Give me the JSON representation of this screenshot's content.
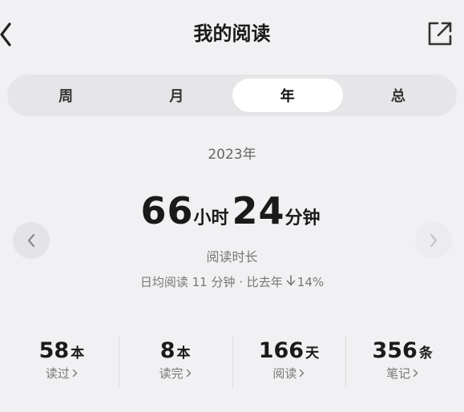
{
  "header": {
    "title": "我的阅读",
    "back_icon": "chevron-left-icon",
    "share_icon": "external-link-icon"
  },
  "tabs": [
    {
      "label": "周",
      "active": false
    },
    {
      "label": "月",
      "active": false
    },
    {
      "label": "年",
      "active": true
    },
    {
      "label": "总",
      "active": false
    }
  ],
  "period": {
    "label": "2023年"
  },
  "duration": {
    "hours": "66",
    "hours_unit": "小时",
    "minutes": "24",
    "minutes_unit": "分钟",
    "label": "阅读时长"
  },
  "daily": {
    "text": "日均阅读 11 分钟 · 比去年",
    "trend_icon": "arrow-down-icon",
    "change": "14%"
  },
  "nav": {
    "prev_icon": "chevron-left-icon",
    "next_icon": "chevron-right-icon"
  },
  "stats": [
    {
      "value": "58",
      "unit": "本",
      "label": "读过"
    },
    {
      "value": "8",
      "unit": "本",
      "label": "读完"
    },
    {
      "value": "166",
      "unit": "天",
      "label": "阅读"
    },
    {
      "value": "356",
      "unit": "条",
      "label": "笔记"
    }
  ],
  "colors": {
    "background": "#f1f1f3",
    "tab_track": "#e6e6e9",
    "tab_active": "#ffffff",
    "text_primary": "#1a1a1a",
    "text_secondary": "#777777"
  }
}
